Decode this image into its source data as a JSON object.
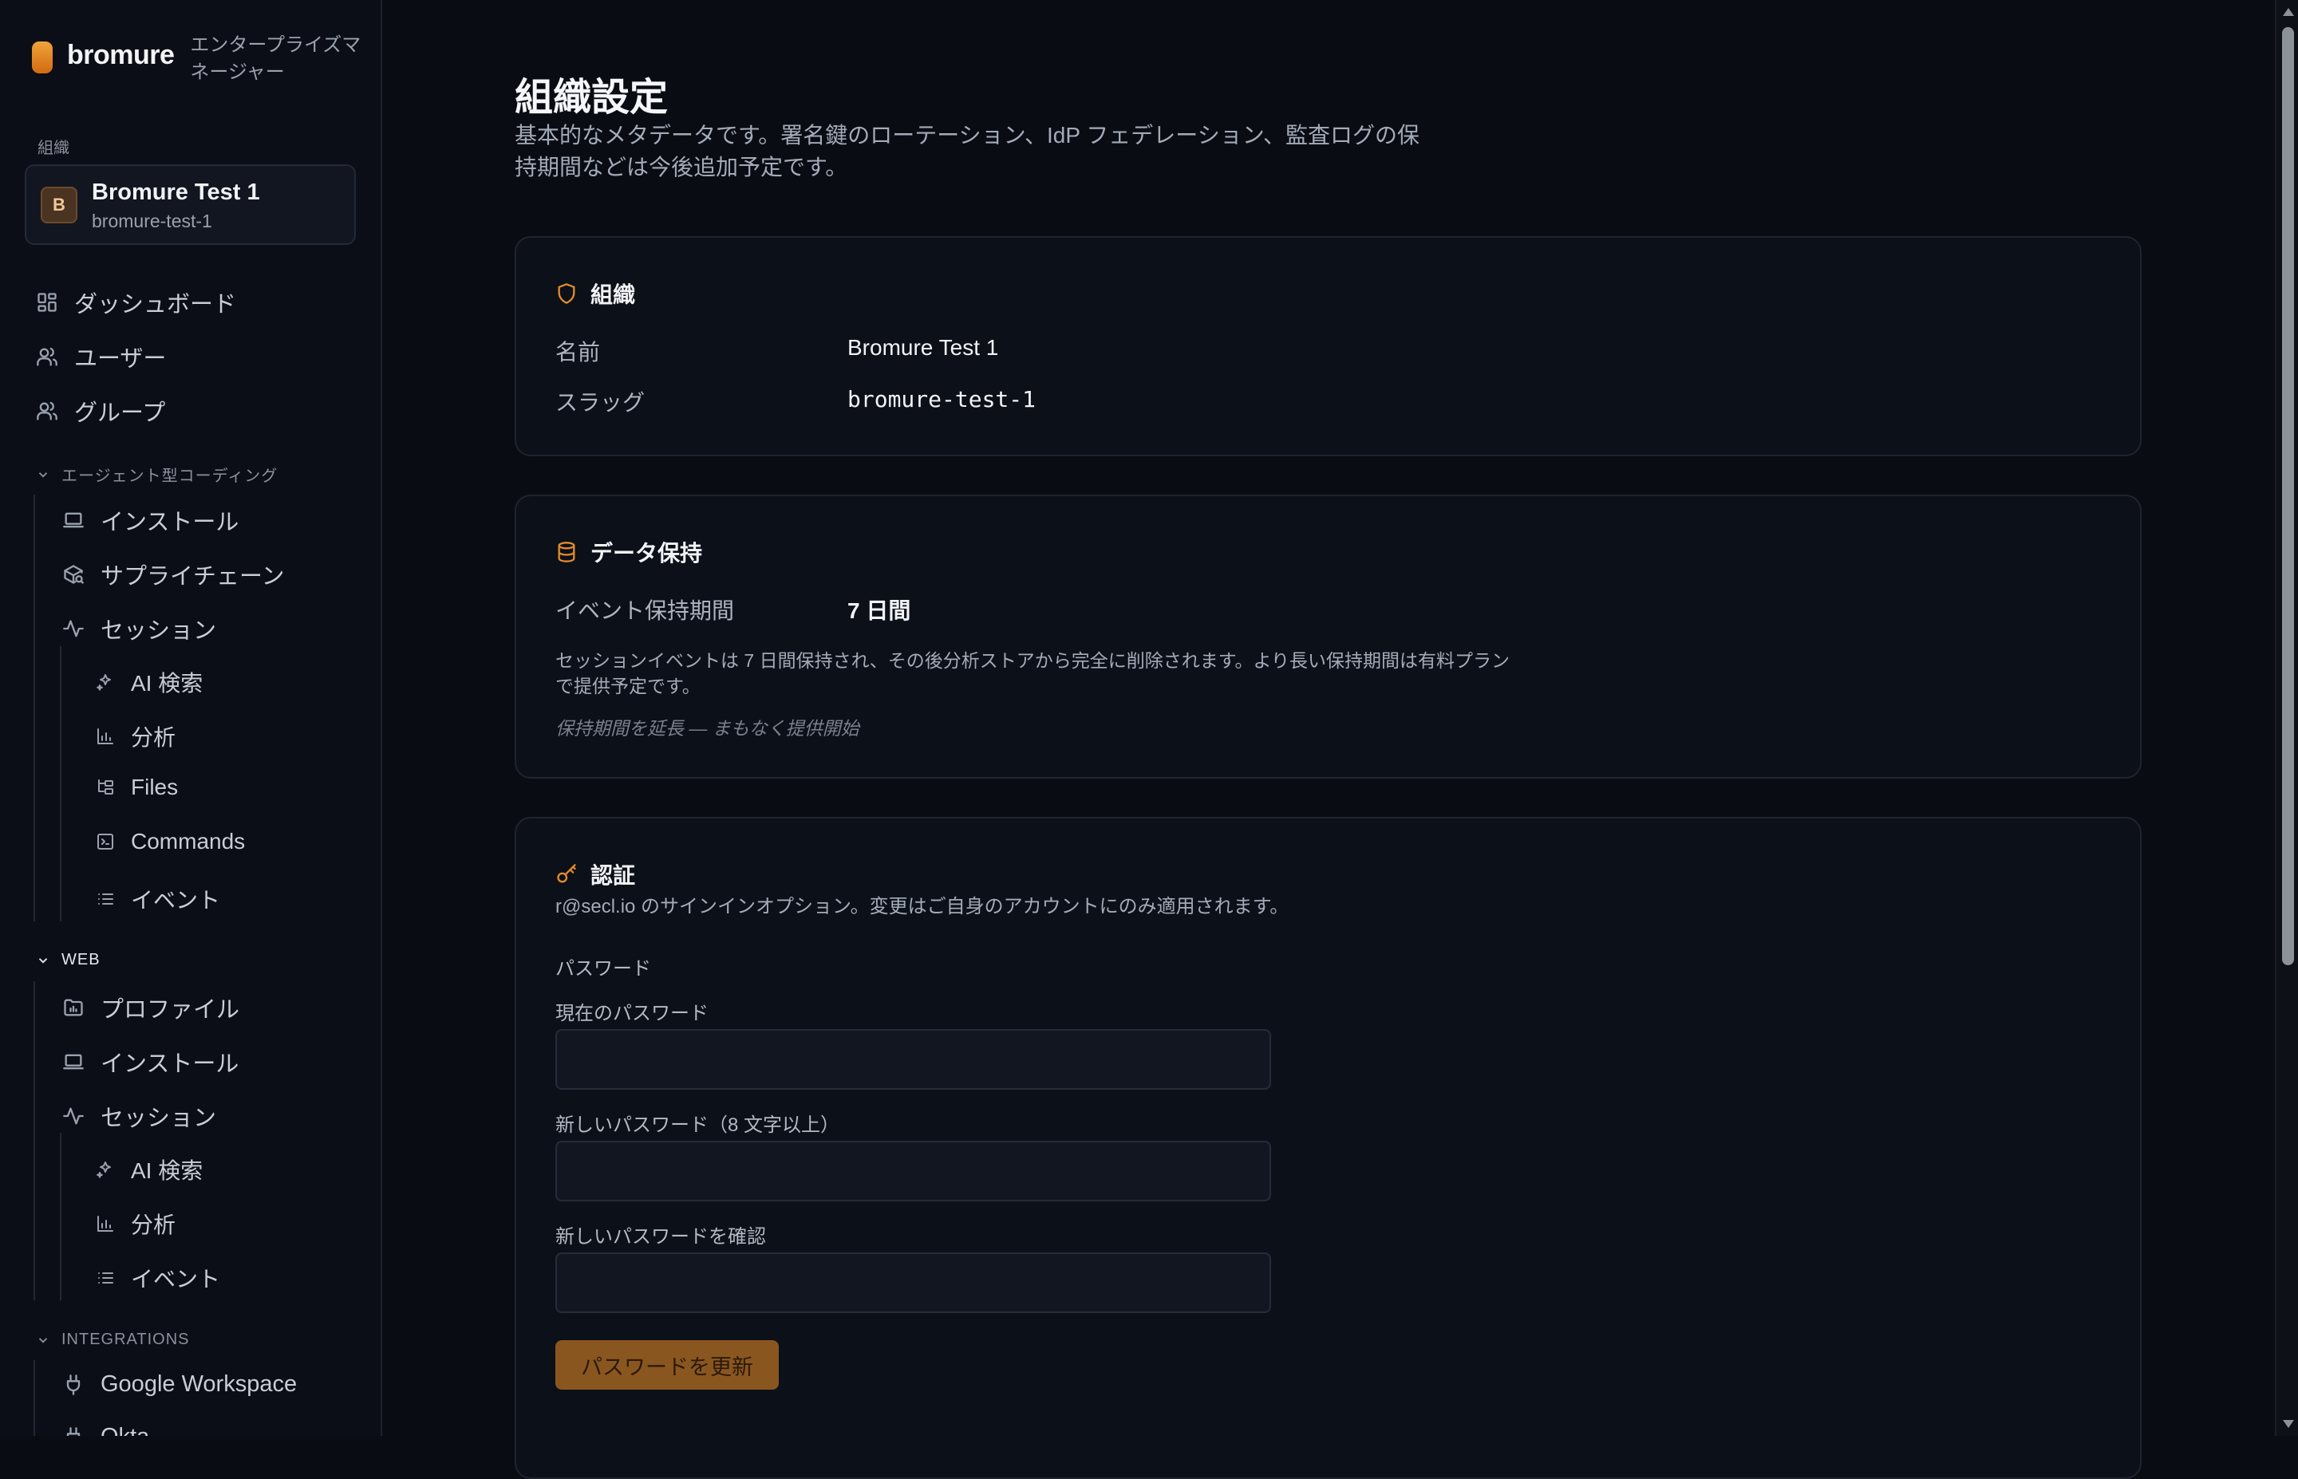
{
  "app": {
    "brand": "bromure",
    "subtitle": "エンタープライズマネージャー"
  },
  "org_switcher": {
    "section_label": "組織",
    "avatar_letter": "B",
    "name": "Bromure Test 1",
    "slug": "bromure-test-1"
  },
  "nav": {
    "dashboard": "ダッシュボード",
    "users": "ユーザー",
    "groups": "グループ",
    "agentic_section": "エージェント型コーディング",
    "agentic": {
      "install": "インストール",
      "supply_chain": "サプライチェーン",
      "sessions": "セッション",
      "ai_search": "AI 検索",
      "analytics": "分析",
      "files": "Files",
      "commands": "Commands",
      "events": "イベント"
    },
    "web_section": "WEB",
    "web": {
      "profiles": "プロファイル",
      "install": "インストール",
      "sessions": "セッション",
      "ai_search": "AI 検索",
      "analytics": "分析",
      "events": "イベント"
    },
    "integrations_section": "INTEGRATIONS",
    "integrations": {
      "google_workspace": "Google Workspace",
      "next_item_partial": "Okta"
    }
  },
  "page": {
    "title": "組織設定",
    "description": "基本的なメタデータです。署名鍵のローテーション、IdP フェデレーション、監査ログの保持期間などは今後追加予定です。"
  },
  "org_card": {
    "title": "組織",
    "name_label": "名前",
    "name_value": "Bromure Test 1",
    "slug_label": "スラッグ",
    "slug_value": "bromure-test-1"
  },
  "retention_card": {
    "title": "データ保持",
    "period_label": "イベント保持期間",
    "period_value": "7 日間",
    "note": "セッションイベントは 7 日間保持され、その後分析ストアから完全に削除されます。より長い保持期間は有料プランで提供予定です。",
    "extend_note": "保持期間を延長 — まもなく提供開始"
  },
  "auth_card": {
    "title": "認証",
    "description": "r@secl.io のサインインオプション。変更はご自身のアカウントにのみ適用されます。",
    "password_section": "パスワード",
    "current_label": "現在のパスワード",
    "current_value": "",
    "new_label": "新しいパスワード（8 文字以上）",
    "new_value": "",
    "confirm_label": "新しいパスワードを確認",
    "confirm_value": "",
    "update_button": "パスワードを更新"
  },
  "colors": {
    "accent": "#e48a2c",
    "button_bg": "#8a561f",
    "background": "#090c13",
    "card_border": "#1f2430"
  }
}
